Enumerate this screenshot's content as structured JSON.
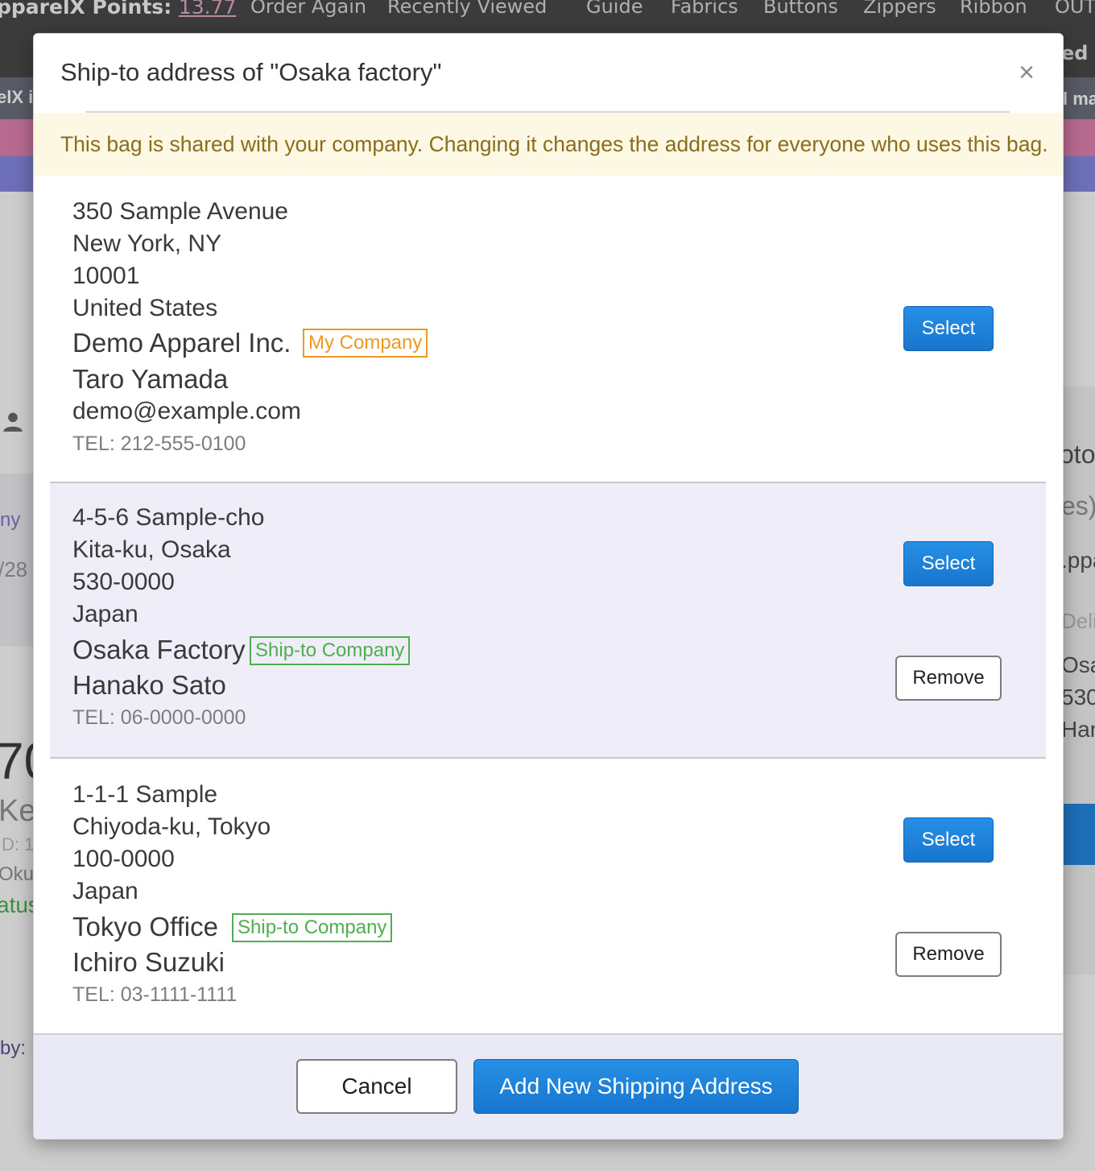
{
  "background": {
    "points_label": "pparelX Points:",
    "points_value": "13.77",
    "nav": [
      "Order Again",
      "Recently Viewed",
      "Guide",
      "Fabrics",
      "Buttons",
      "Zippers",
      "Ribbon",
      "OUTL"
    ],
    "frag_right_top": "ed S",
    "frag_band_left": "elX is",
    "frag_band_right": "l ma",
    "frag_left": [
      "ny",
      "/28",
      "70",
      "Ke",
      "D: 1",
      "Oku",
      "atus",
      "by:"
    ],
    "frag_right": [
      "oto",
      "es)",
      ".ppa",
      "Deli",
      "Osa",
      "530",
      "Han"
    ]
  },
  "modal": {
    "title": "Ship-to address of \"Osaka factory\"",
    "close_glyph": "×",
    "notice": "This bag is shared with your company. Changing it changes the address for everyone who uses this bag.",
    "select_label": "Select",
    "remove_label": "Remove",
    "addresses": [
      {
        "street": "350 Sample Avenue",
        "city": "New York, NY",
        "postal": "10001",
        "country": "United States",
        "company": "Demo Apparel Inc.",
        "badge": "My Company",
        "contact": "Taro Yamada",
        "email": "demo@example.com",
        "tel": "TEL: 212-555-0100"
      },
      {
        "street": "4-5-6 Sample-cho",
        "city": "Kita-ku, Osaka",
        "postal": "530-0000",
        "country": "Japan",
        "company": "Osaka Factory",
        "badge": "Ship-to Company",
        "contact": "Hanako Sato",
        "tel": "TEL: 06-0000-0000"
      },
      {
        "street": "1-1-1 Sample",
        "city": "Chiyoda-ku, Tokyo",
        "postal": "100-0000",
        "country": "Japan",
        "company": "Tokyo Office",
        "badge": "Ship-to Company",
        "contact": "Ichiro Suzuki",
        "tel": "TEL: 03-1111-1111"
      }
    ],
    "footer": {
      "cancel_label": "Cancel",
      "add_label": "Add New Shipping Address"
    }
  },
  "colors": {
    "primary_button": "#1a7bd4",
    "my_company_badge": "#ec9a22",
    "ship_to_badge": "#4fae4f",
    "notice_bg": "#fcf8e3",
    "notice_text": "#8a6d1e",
    "selected_row_bg": "#eeedf8"
  }
}
